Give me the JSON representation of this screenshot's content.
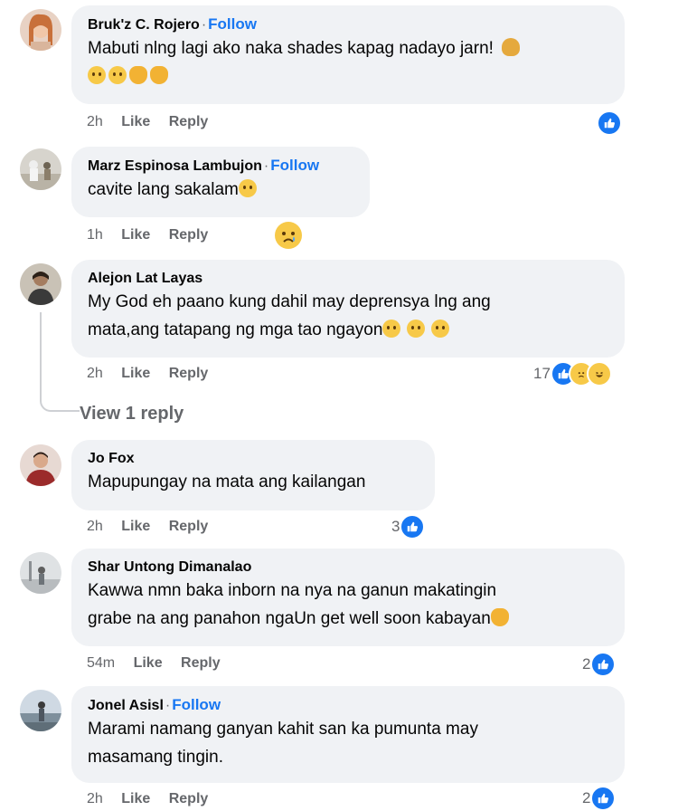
{
  "comments": [
    {
      "name": "Bruk'z C. Rojero",
      "follow": "Follow",
      "lines": [
        "Mabuti nlng lagi ako naka shades kapag nadayo jarn!"
      ],
      "time": "2h",
      "like": "Like",
      "reply": "Reply",
      "reaction_count": ""
    },
    {
      "name": "Marz Espinosa Lambujon",
      "follow": "Follow",
      "lines": [
        "cavite lang sakalam"
      ],
      "time": "1h",
      "like": "Like",
      "reply": "Reply",
      "reaction_count": ""
    },
    {
      "name": "Alejon Lat Layas",
      "lines": [
        "My God eh paano kung dahil may deprensya lng ang",
        "mata,ang tatapang ng mga tao ngayon"
      ],
      "time": "2h",
      "like": "Like",
      "reply": "Reply",
      "reaction_count": "17",
      "view_reply": "View 1 reply"
    },
    {
      "name": "Jo Fox",
      "lines": [
        "Mapupungay na mata ang kailangan"
      ],
      "time": "2h",
      "like": "Like",
      "reply": "Reply",
      "reaction_count": "3"
    },
    {
      "name": "Shar Untong Dimanalao",
      "lines": [
        "Kawwa nmn baka inborn na nya na ganun makatingin",
        "grabe na ang panahon ngaUn get well soon kabayan"
      ],
      "time": "54m",
      "like": "Like",
      "reply": "Reply",
      "reaction_count": "2"
    },
    {
      "name": "Jonel Asisl",
      "follow": "Follow",
      "lines": [
        "Marami namang ganyan kahit san ka pumunta may",
        "masamang tingin."
      ],
      "time": "2h",
      "like": "Like",
      "reply": "Reply",
      "reaction_count": "2"
    }
  ],
  "colors": {
    "link": "#1877f2",
    "bubble": "#f0f2f5",
    "meta": "#65676b"
  }
}
